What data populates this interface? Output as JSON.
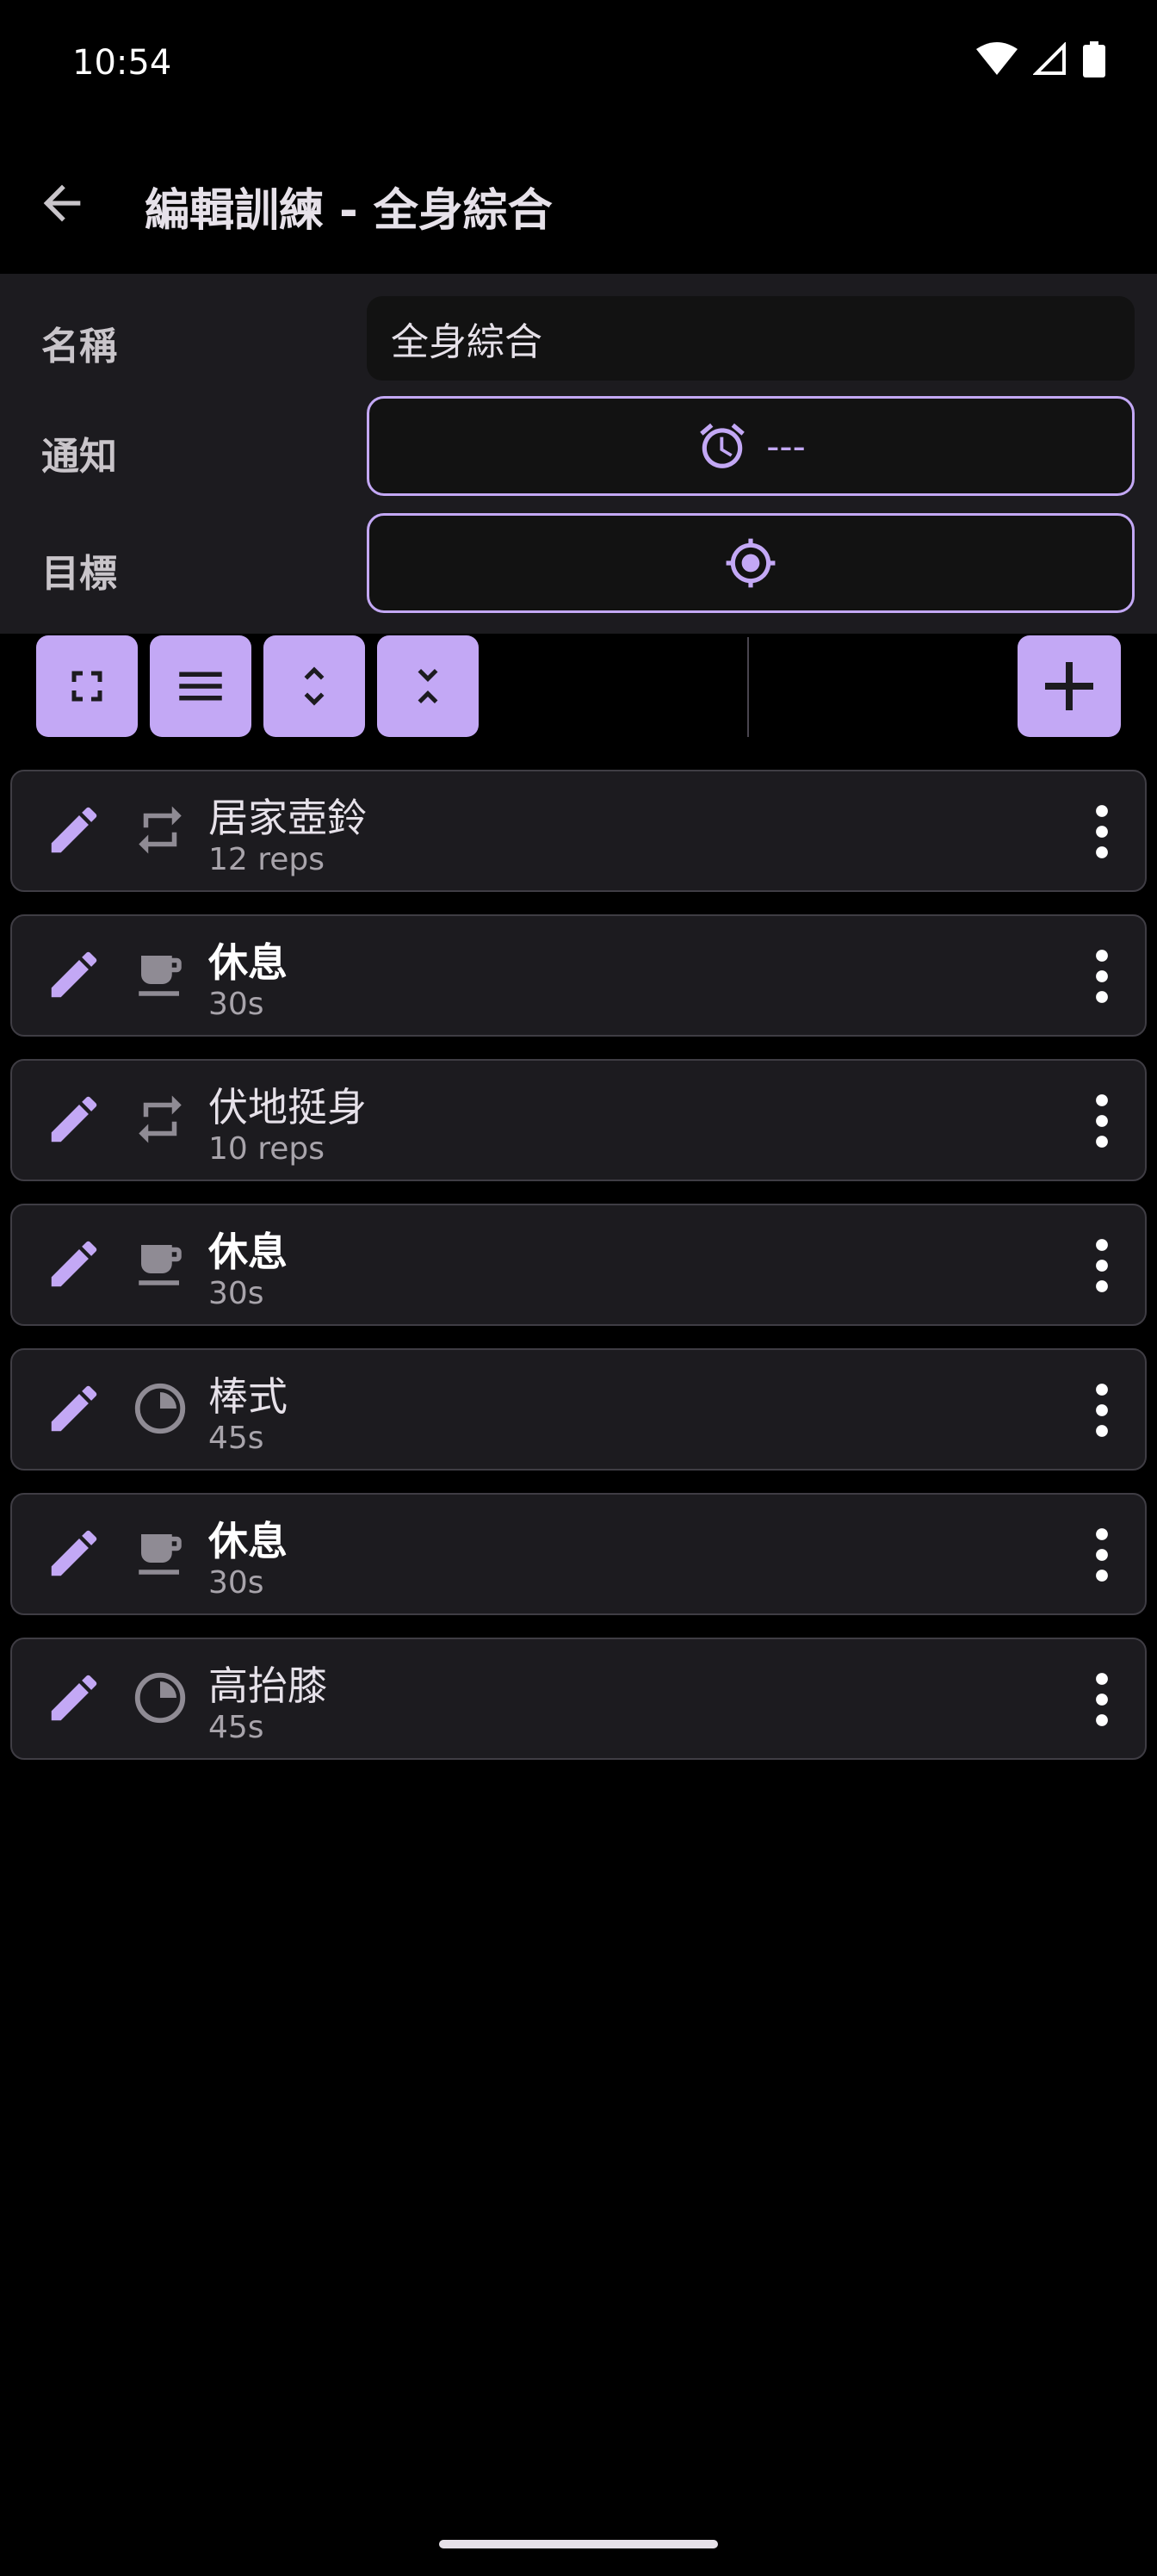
{
  "status": {
    "time": "10:54"
  },
  "app_bar": {
    "title": "編輯訓練 - 全身綜合"
  },
  "form": {
    "name_label": "名稱",
    "name_value": "全身綜合",
    "notify_label": "通知",
    "notify_value": "---",
    "goal_label": "目標"
  },
  "exercises": [
    {
      "name": "居家壺鈴",
      "sub": "12 reps",
      "type": "repeat-icon"
    },
    {
      "name": "休息",
      "sub": "30s",
      "type": "coffee-cup-icon"
    },
    {
      "name": "伏地挺身",
      "sub": "10 reps",
      "type": "repeat-icon"
    },
    {
      "name": "休息",
      "sub": "30s",
      "type": "coffee-cup-icon"
    },
    {
      "name": "棒式",
      "sub": "45s",
      "type": "timer-pie-icon"
    },
    {
      "name": "休息",
      "sub": "30s",
      "type": "coffee-cup-icon"
    },
    {
      "name": "高抬膝",
      "sub": "45s",
      "type": "timer-pie-icon"
    }
  ],
  "colors": {
    "accent": "#c3a8f5",
    "surface": "#1c1b1f",
    "background": "#000000"
  }
}
